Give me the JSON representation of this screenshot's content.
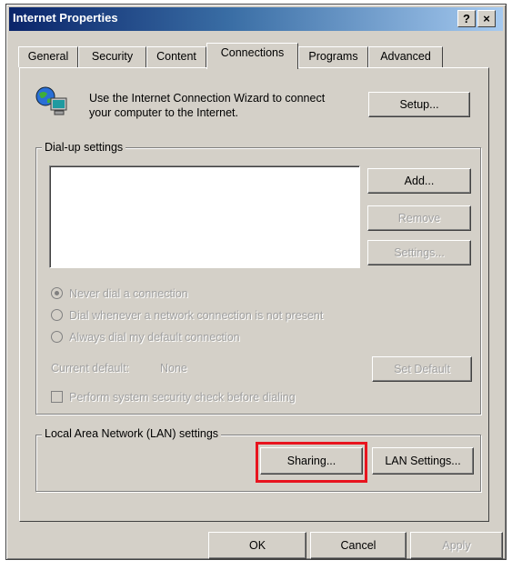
{
  "window": {
    "title": "Internet Properties",
    "help_button": "?",
    "close_button": "×"
  },
  "tabs": [
    {
      "label": "General"
    },
    {
      "label": "Security"
    },
    {
      "label": "Content"
    },
    {
      "label": "Connections",
      "active": true
    },
    {
      "label": "Programs"
    },
    {
      "label": "Advanced"
    }
  ],
  "wizard": {
    "text": "Use the Internet Connection Wizard to connect your computer to the Internet.",
    "setup_button": "Setup...",
    "icon": "computer-globe-icon"
  },
  "dialup": {
    "legend": "Dial-up settings",
    "add_button": "Add...",
    "remove_button": "Remove",
    "settings_button": "Settings...",
    "radio_options": [
      {
        "label": "Never dial a connection",
        "selected": true
      },
      {
        "label": "Dial whenever a network connection is not present",
        "selected": false
      },
      {
        "label": "Always dial my default connection",
        "selected": false
      }
    ],
    "current_default_label": "Current default:",
    "current_default_value": "None",
    "set_default_button": "Set Default",
    "security_check_label": "Perform system security check before dialing"
  },
  "lan": {
    "legend": "Local Area Network (LAN) settings",
    "sharing_button": "Sharing...",
    "lan_settings_button": "LAN Settings..."
  },
  "footer": {
    "ok_button": "OK",
    "cancel_button": "Cancel",
    "apply_button": "Apply"
  },
  "colors": {
    "highlight": "#e8141e",
    "titlebar_start": "#0a246a",
    "face": "#d4d0c8"
  }
}
